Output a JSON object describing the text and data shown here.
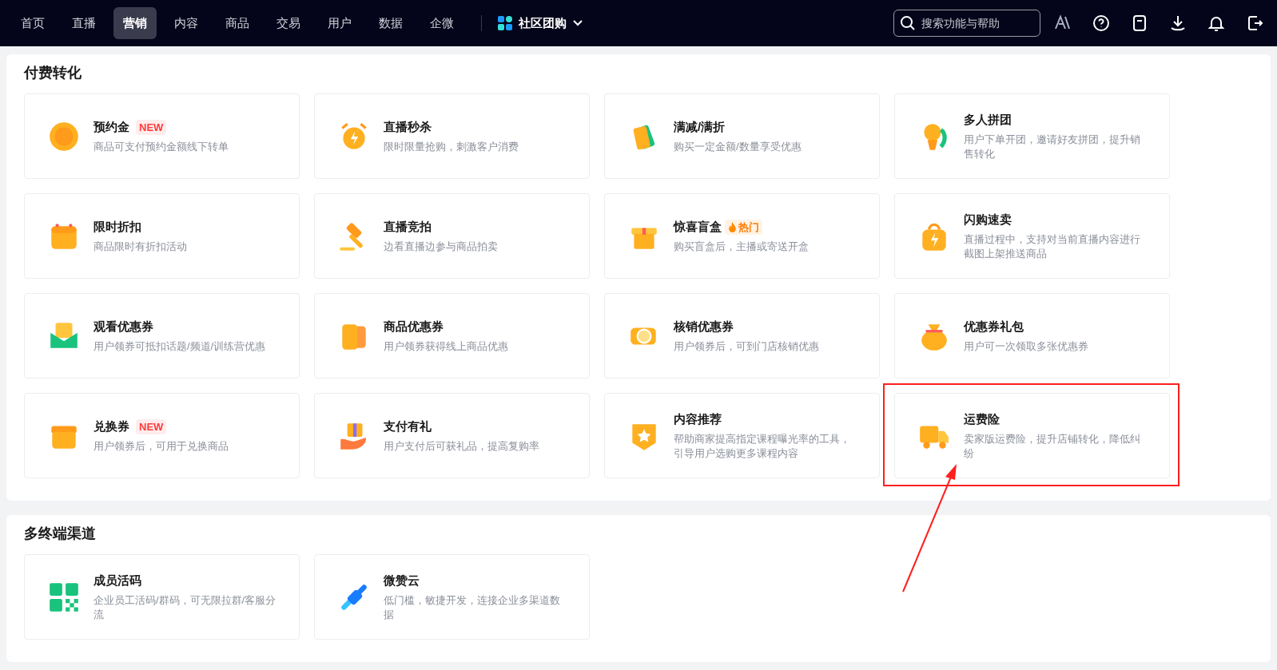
{
  "nav": {
    "tabs": [
      {
        "label": "首页",
        "selected": false
      },
      {
        "label": "直播",
        "selected": false
      },
      {
        "label": "营销",
        "selected": true
      },
      {
        "label": "内容",
        "selected": false
      },
      {
        "label": "商品",
        "selected": false
      },
      {
        "label": "交易",
        "selected": false
      },
      {
        "label": "用户",
        "selected": false
      },
      {
        "label": "数据",
        "selected": false
      },
      {
        "label": "企微",
        "selected": false
      }
    ],
    "workspace": "社区团购",
    "search": {
      "placeholder": "搜索功能与帮助"
    }
  },
  "sections": [
    {
      "title": "付费转化",
      "cards": [
        {
          "title": "预约金",
          "badge": {
            "kind": "new",
            "text": "NEW"
          },
          "desc": "商品可支付预约金额线下转单"
        },
        {
          "title": "直播秒杀",
          "desc": "限时限量抢购，刺激客户消费"
        },
        {
          "title": "满减/满折",
          "desc": "购买一定金额/数量享受优惠"
        },
        {
          "title": "多人拼团",
          "desc": "用户下单开团，邀请好友拼团，提升销售转化"
        },
        {
          "title": "限时折扣",
          "desc": "商品限时有折扣活动"
        },
        {
          "title": "直播竞拍",
          "desc": "边看直播边参与商品拍卖"
        },
        {
          "title": "惊喜盲盒",
          "badge": {
            "kind": "hot",
            "text": "热门"
          },
          "desc": "购买盲盒后，主播或寄送开盒"
        },
        {
          "title": "闪购速卖",
          "desc": "直播过程中，支持对当前直播内容进行截图上架推送商品"
        },
        {
          "title": "观看优惠券",
          "desc": "用户领券可抵扣话题/频道/训练营优惠"
        },
        {
          "title": "商品优惠券",
          "desc": "用户领券获得线上商品优惠"
        },
        {
          "title": "核销优惠券",
          "desc": "用户领券后，可到门店核销优惠"
        },
        {
          "title": "优惠券礼包",
          "desc": "用户可一次领取多张优惠券"
        },
        {
          "title": "兑换券",
          "badge": {
            "kind": "new",
            "text": "NEW"
          },
          "desc": "用户领券后，可用于兑换商品"
        },
        {
          "title": "支付有礼",
          "desc": "用户支付后可获礼品，提高复购率"
        },
        {
          "title": "内容推荐",
          "desc": "帮助商家提高指定课程曝光率的工具，引导用户选购更多课程内容"
        },
        {
          "title": "运费险",
          "desc": "卖家版运费险，提升店铺转化，降低纠纷",
          "highlighted": true
        }
      ]
    },
    {
      "title": "多终端渠道",
      "cards": [
        {
          "title": "成员活码",
          "desc": "企业员工活码/群码，可无限拉群/客服分流"
        },
        {
          "title": "微赞云",
          "desc": "低门槛，敏捷开发，连接企业多渠道数据"
        }
      ]
    }
  ]
}
